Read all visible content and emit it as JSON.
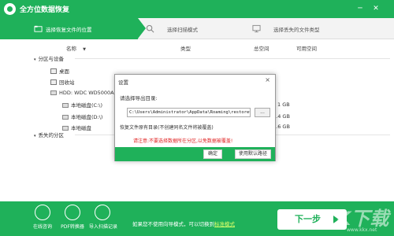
{
  "app": {
    "title": "全方位数据恢复"
  },
  "steps": [
    {
      "label": "选择恢复文件的位置"
    },
    {
      "label": "选择扫描模式"
    },
    {
      "label": "选择丢失的文件类型"
    }
  ],
  "columns": {
    "name": "名称",
    "type": "类型",
    "total": "总空间",
    "free": "可用空间"
  },
  "tree": {
    "section_partitions": "分区与设备",
    "desktop": "桌面",
    "recycle_bin": "回收站",
    "hdd": "HDD: WDC WD5000AZ",
    "disk_c": "本地磁盘(C:\\)",
    "disk_d": "本地磁盘(D:\\)",
    "disk_e": "本地磁盘",
    "section_lost": "丢失的分区",
    "free_c": "1 GB",
    "free_d": "5.4 GB",
    "free_e": "1.6 GB"
  },
  "dialog": {
    "title": "设置",
    "close": "×",
    "prompt": "请选择导出目录:",
    "path": "C:\\Users\\Administrator\\AppData\\Roaming\\restoreCache",
    "browse": "...",
    "note": "恢复文件原有目录(不创建同名文件将被覆盖)",
    "warning": "请注意:不要选择数据所在分区,以免数据被覆盖!",
    "ok": "确定",
    "default_path": "使用默认路径"
  },
  "footer": {
    "items": [
      {
        "label": "在线咨询"
      },
      {
        "label": "PDF转换器"
      },
      {
        "label": "导入扫描记录"
      }
    ],
    "message": "如果您不使用向导模式，可以切换到",
    "link": "标准模式",
    "next": "下一步"
  },
  "watermark": {
    "text": "KK下载",
    "sub": "www.kkx.net"
  },
  "colors": {
    "accent": "#1fb15a",
    "warning": "#e02020"
  }
}
